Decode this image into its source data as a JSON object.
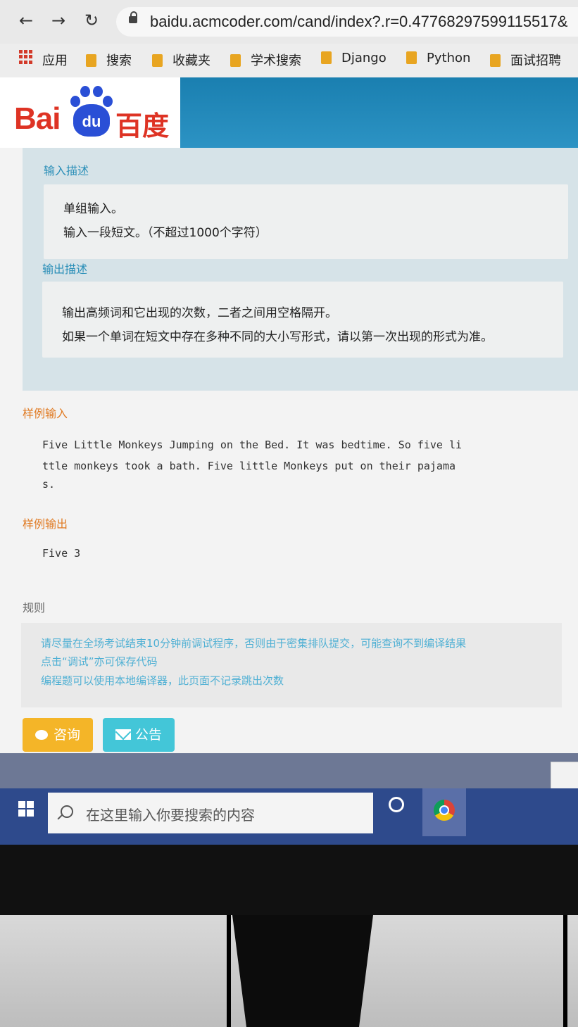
{
  "browser": {
    "url": "baidu.acmcoder.com/cand/index?.r=0.47768297599115517&",
    "bookmarks": [
      "应用",
      "搜索",
      "收藏夹",
      "学术搜索",
      "Django",
      "Python",
      "面试招聘"
    ]
  },
  "logo": {
    "latin": "Bai",
    "paw": "du",
    "chinese": "百度"
  },
  "problem": {
    "input_label": "输入描述",
    "input_lines": [
      "单组输入。",
      "输入一段短文。（不超过1000个字符）"
    ],
    "output_label": "输出描述",
    "output_lines": [
      "输出高频词和它出现的次数，二者之间用空格隔开。",
      "如果一个单词在短文中存在多种不同的大小写形式，请以第一次出现的形式为准。"
    ],
    "sample_input_label": "样例输入",
    "sample_input_lines": [
      "Five Little Monkeys Jumping on the Bed. It was bedtime. So five li",
      "ttle monkeys took a bath. Five little Monkeys put on their pajama",
      "s."
    ],
    "sample_output_label": "样例输出",
    "sample_output": "Five 3",
    "rules_label": "规则",
    "rules_lines": [
      "请尽量在全场考试结束10分钟前调试程序，否则由于密集排队提交，可能查询不到编译结果",
      "点击“调试”亦可保存代码",
      "编程题可以使用本地编译器，此页面不记录跳出次数"
    ]
  },
  "buttons": {
    "consult": "咨询",
    "notice": "公告"
  },
  "taskbar": {
    "search_placeholder": "在这里输入你要搜索的内容"
  },
  "colors": {
    "accent_blue": "#2b8fb8",
    "accent_orange": "#e07a22",
    "consult_btn": "#f4b528",
    "notice_btn": "#43c6d8"
  }
}
